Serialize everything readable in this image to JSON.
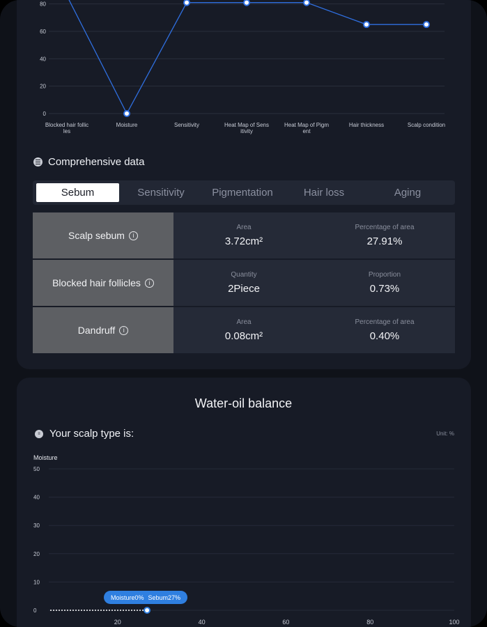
{
  "trend_chart": {
    "y_ticks": [
      "0",
      "20",
      "40",
      "60",
      "80"
    ],
    "categories": [
      [
        "Blocked hair follic",
        "les"
      ],
      [
        "Moisture"
      ],
      [
        "Sensitivity"
      ],
      [
        "Heat Map of Sens",
        "itivity"
      ],
      [
        "Heat Map of Pigm",
        "ent"
      ],
      [
        "Hair thickness"
      ],
      [
        "Scalp condition"
      ]
    ],
    "values": [
      86,
      0,
      81,
      81,
      81,
      65,
      65
    ],
    "ylim": [
      0,
      90
    ],
    "line_color": "#2f6fe0"
  },
  "comprehensive": {
    "title": "Comprehensive data",
    "icon": "list-icon",
    "tabs": [
      "Sebum",
      "Sensitivity",
      "Pigmentation",
      "Hair loss",
      "Aging"
    ],
    "active_tab": "Sebum",
    "rows": [
      {
        "label": "Scalp sebum",
        "k1": "Area",
        "v1": "3.72cm²",
        "k2": "Percentage of area",
        "v2": "27.91%"
      },
      {
        "label": "Blocked hair follicles",
        "k1": "Quantity",
        "v1": "2Piece",
        "k2": "Proportion",
        "v2": "0.73%"
      },
      {
        "label": "Dandruff",
        "k1": "Area",
        "v1": "0.08cm²",
        "k2": "Percentage of area",
        "v2": "0.40%"
      }
    ]
  },
  "water_oil": {
    "title": "Water-oil balance",
    "scalp_type_label": "Your scalp type is:",
    "unit": "Unit: %",
    "y_axis_title": "Moisture",
    "y_ticks": [
      "0",
      "10",
      "20",
      "30",
      "40",
      "50"
    ],
    "x_ticks": [
      "20",
      "40",
      "60",
      "80",
      "100"
    ],
    "point": {
      "sebum": 27,
      "moisture": 0
    },
    "tooltip_moisture": "Moisture0%",
    "tooltip_sebum": "Sebum27%"
  },
  "chart_data": [
    {
      "type": "line",
      "categories": [
        "Blocked hair follicles",
        "Moisture",
        "Sensitivity",
        "Heat Map of Sensitivity",
        "Heat Map of Pigment",
        "Hair thickness",
        "Scalp condition"
      ],
      "values": [
        86,
        0,
        81,
        81,
        81,
        65,
        65
      ],
      "ylim": [
        0,
        90
      ],
      "y_ticks": [
        0,
        20,
        40,
        60,
        80
      ],
      "grid": true
    },
    {
      "type": "scatter",
      "x": [
        27
      ],
      "y": [
        0
      ],
      "xlabel": "",
      "ylabel": "Moisture",
      "xlim": [
        0,
        100
      ],
      "ylim": [
        0,
        50
      ],
      "x_ticks": [
        20,
        40,
        60,
        80,
        100
      ],
      "y_ticks": [
        0,
        10,
        20,
        30,
        40,
        50
      ],
      "annotations": [
        "Moisture0%",
        "Sebum27%"
      ],
      "grid": true
    }
  ]
}
